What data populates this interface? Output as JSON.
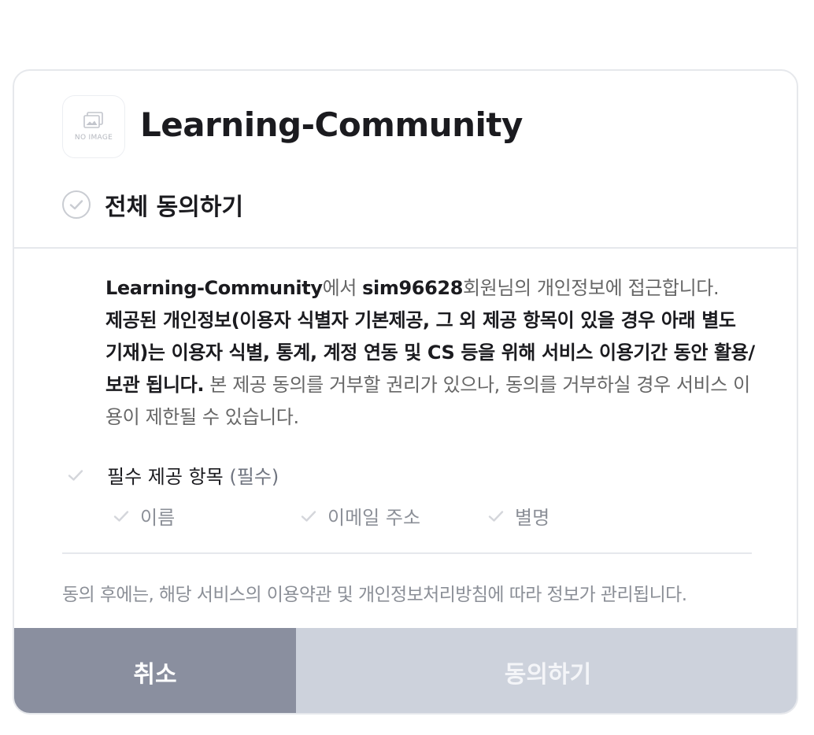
{
  "app": {
    "name": "Learning-Community",
    "logo_placeholder": "NO IMAGE",
    "logo_icon": "image-placeholder-icon"
  },
  "agree_all": {
    "label": "전체 동의하기",
    "icon": "circle-check-icon"
  },
  "consent": {
    "app_name": "Learning-Community",
    "text_access_prefix": "에서 ",
    "user_id": "sim96628",
    "text_access_suffix": "회원님의 개인정보에 접근합니다.",
    "bold_statement": "제공된 개인정보(이용자 식별자 기본제공, 그 외 제공 항목이 있을 경우 아래 별도 기재)는 이용자 식별, 통계, 계정 연동 및 CS 등을 위해 서비스 이용기간 동안 활용/보관 됩니다.",
    "notice": " 본 제공 동의를 거부할 권리가 있으나, 동의를 거부하실 경우 서비스 이용이 제한될 수 있습니다."
  },
  "required": {
    "title": "필수 제공 항목",
    "tag": "(필수)",
    "items": [
      {
        "label": "이름"
      },
      {
        "label": "이메일 주소"
      },
      {
        "label": "별명"
      }
    ]
  },
  "footer_note": "동의 후에는, 해당 서비스의 이용약관 및 개인정보처리방침에 따라 정보가 관리됩니다.",
  "buttons": {
    "cancel": "취소",
    "agree": "동의하기"
  },
  "colors": {
    "cancel_bg": "#8a8f9f",
    "agree_bg_disabled": "#cdd2dc",
    "border": "#e6e8ec",
    "check_gray": "#c9ccd2"
  }
}
